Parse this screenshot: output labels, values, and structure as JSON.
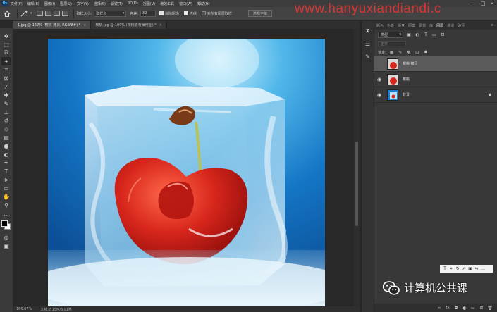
{
  "app": {
    "logo": "Ps"
  },
  "menu": [
    "文件(F)",
    "编辑(E)",
    "图像(I)",
    "图层(L)",
    "文字(Y)",
    "选择(S)",
    "滤镜(T)",
    "3D(D)",
    "视图(V)",
    "增效工具",
    "窗口(W)",
    "帮助(H)"
  ],
  "watermark": "www.hanyuxiandiandi.c",
  "options": {
    "sample_label": "取样大小:",
    "sample_value": "取样点",
    "tolerance_label": "容差:",
    "tolerance_value": "32",
    "antialias": "消除锯齿",
    "contiguous": "连续",
    "all_layers": "对所有图层取样",
    "select_subject": "选择主体"
  },
  "tabs": [
    {
      "label": "1.jpg @ 167% (樱桃 拷贝, RGB/8#) *",
      "active": true
    },
    {
      "label": "樱桃.jpg @ 100% (樱桃去背景用图) *",
      "active": false
    }
  ],
  "status": {
    "zoom": "166.67%",
    "doc": "文档:2.15M/6.91M"
  },
  "panel_tabs": [
    "颜色",
    "色板",
    "渐变",
    "图案",
    "调整",
    "库",
    "图层",
    "通道",
    "路径"
  ],
  "active_panel_tab": "图层",
  "layer_filter": "类型",
  "blend_mode": "正常",
  "lock_label": "锁定:",
  "layers": [
    {
      "name": "樱桃 拷贝",
      "selected": true,
      "visible": false,
      "locked": false,
      "thumb": "cherry"
    },
    {
      "name": "樱桃",
      "selected": false,
      "visible": true,
      "locked": false,
      "thumb": "cherry"
    },
    {
      "name": "背景",
      "selected": false,
      "visible": true,
      "locked": true,
      "thumb": "ice"
    }
  ],
  "wechat_label": "计算机公共课",
  "colors": {
    "accent": "#1c7fd0",
    "cherry": "#d8261c",
    "ice": "#bfe3f5"
  }
}
